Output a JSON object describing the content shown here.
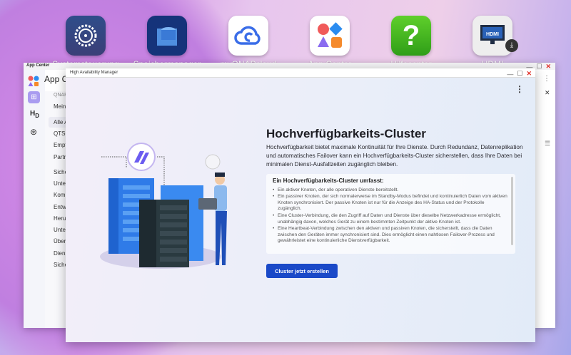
{
  "desktop": {
    "icons": [
      {
        "label": "Systemsteuerung",
        "icon": "gear-icon",
        "color": "#2d3f7a"
      },
      {
        "label": "Speichermanager",
        "icon": "database-icon",
        "color": "#15337a"
      },
      {
        "label": "myQNAPcloud",
        "icon": "cloud-icon",
        "color": "#ffffff"
      },
      {
        "label": "App Center",
        "icon": "app-grid-icon",
        "color": "#ffffff"
      },
      {
        "label": "Hilfecenter",
        "icon": "question-icon",
        "color": "#43b51e"
      },
      {
        "label": "HDMI",
        "icon": "hdmi-monitor-icon",
        "color": "#eeeeee"
      }
    ]
  },
  "app_center": {
    "title": "App Center",
    "header": "App Ce",
    "sidebar": [
      "QNAP :",
      "Meine",
      "Alle A",
      "QTS-",
      "Empf",
      "Partn",
      "Siche",
      "Unter",
      "Komm",
      "Entwi",
      "Herur",
      "Unter",
      "Überv",
      "Diens",
      "Siche"
    ],
    "selected": "Alle A"
  },
  "ha": {
    "title": "High Availability Manager",
    "heading": "Hochverfügbarkeits-Cluster",
    "intro": "Hochverfügbarkeit bietet maximale Kontinuität für Ihre Dienste. Durch Redundanz, Datenreplikation und automatisches Failover kann ein Hochverfügbarkeits-Cluster sicherstellen, dass Ihre Daten bei minimalen Dienst-Ausfallzeiten zugänglich bleiben.",
    "box_title": "Ein Hochverfügbarkeits-Cluster umfasst:",
    "items": [
      "Ein aktiver Knoten, der alle operativen Dienste bereitstellt.",
      "Ein passiver Knoten, der sich normalerweise im Standby-Modus befindet und kontinuierlich Daten vom aktiven Knoten synchronisiert. Der passive Knoten ist nur für die Anzeige des HA-Status und der Protokolle zugänglich.",
      "Eine Cluster-Verbindung, die den Zugriff auf Daten und Dienste über dieselbe Netzwerkadresse ermöglicht, unabhängig davon, welches Gerät zu einem bestimmten Zeitpunkt der aktive Knoten ist.",
      "Eine Heartbeat-Verbindung zwischen den aktiven und passiven Knoten, die sicherstellt, dass die Daten zwischen den Geräten immer synchronisiert sind. Dies ermöglicht einen nahtlosen Failover-Prozess und gewährleistet eine kontinuierliche Dienstverfügbarkeit."
    ],
    "button": "Cluster jetzt erstellen",
    "accent": "#1a49c8"
  }
}
